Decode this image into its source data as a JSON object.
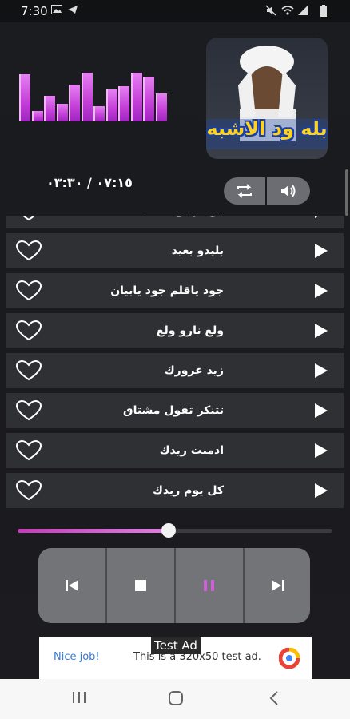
{
  "status_bar": {
    "time": "7:30",
    "icons": [
      "image-icon",
      "telegram-icon",
      "mute-icon",
      "wifi-icon",
      "signal-icon",
      "battery-icon"
    ]
  },
  "visualizer": {
    "levels": [
      0.92,
      0.2,
      0.5,
      0.35,
      0.72,
      0.96,
      0.3,
      0.62,
      0.68,
      0.95,
      0.88,
      0.55
    ]
  },
  "player": {
    "timer": "٠٧:١٥ / ٠٣:٣٠",
    "cover_title": "بله ود الاشبه",
    "repeat_label": "repeat-icon",
    "volume_label": "volume-icon"
  },
  "tracks": [
    {
      "title": "ياخ ارجوك تعال"
    },
    {
      "title": "بليدو بعيد"
    },
    {
      "title": "جود ياقلم جود يابيان"
    },
    {
      "title": "ولع نارو ولع"
    },
    {
      "title": "زيد غرورك"
    },
    {
      "title": "تتنكر تقول مشتاق"
    },
    {
      "title": "ادمنت ريدك"
    },
    {
      "title": "كل يوم ريدك"
    }
  ],
  "seek": {
    "progress": 0.48
  },
  "controls": [
    "previous-icon",
    "stop-icon",
    "pause-icon",
    "next-icon"
  ],
  "ad": {
    "tag": "Test Ad",
    "nice": "Nice job!",
    "text": "This is a 320x50 test ad."
  },
  "colors": {
    "accent": "#c43fd8",
    "pause": "#d05fd8",
    "row": "#2f3034"
  }
}
